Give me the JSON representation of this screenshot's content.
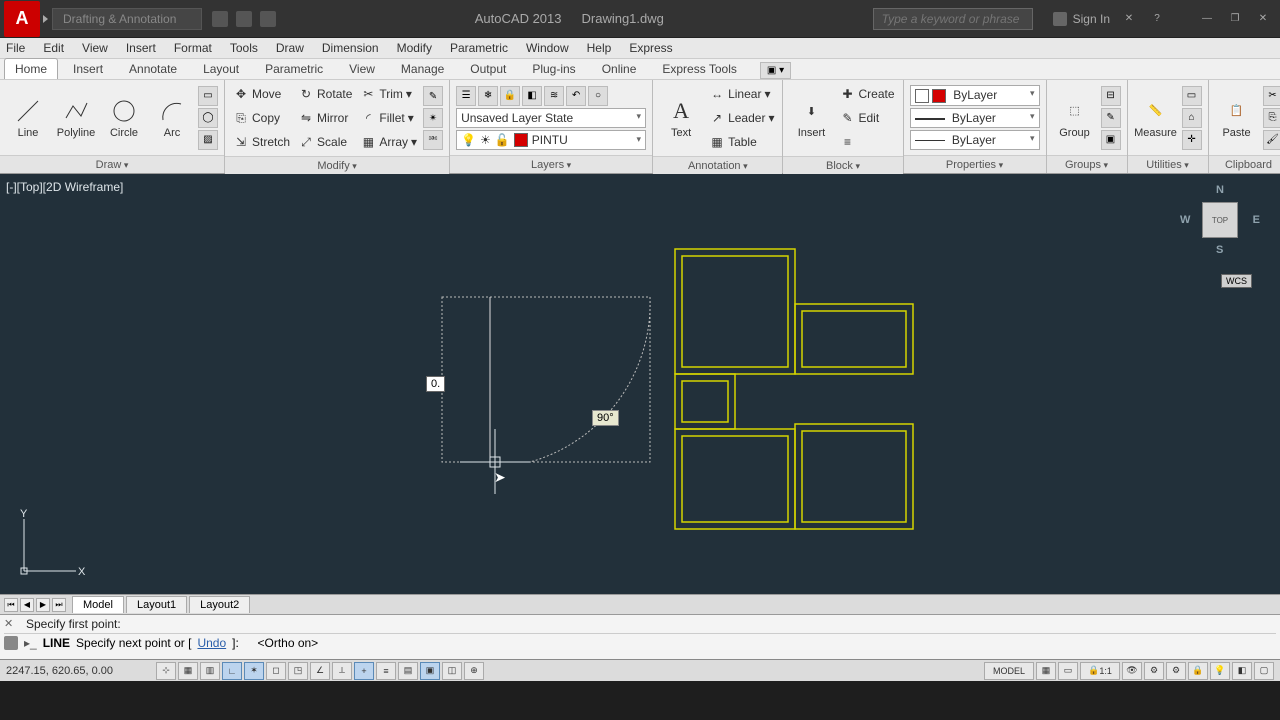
{
  "titlebar": {
    "workspace": "Drafting & Annotation",
    "app": "AutoCAD 2013",
    "doc": "Drawing1.dwg",
    "search_placeholder": "Type a keyword or phrase",
    "signin": "Sign In"
  },
  "menubar": [
    "File",
    "Edit",
    "View",
    "Insert",
    "Format",
    "Tools",
    "Draw",
    "Dimension",
    "Modify",
    "Parametric",
    "Window",
    "Help",
    "Express"
  ],
  "ribbon_tabs": [
    "Home",
    "Insert",
    "Annotate",
    "Layout",
    "Parametric",
    "View",
    "Manage",
    "Output",
    "Plug-ins",
    "Online",
    "Express Tools"
  ],
  "active_tab": "Home",
  "draw_panel": {
    "title": "Draw",
    "items": [
      "Line",
      "Polyline",
      "Circle",
      "Arc"
    ]
  },
  "modify_panel": {
    "title": "Modify",
    "rows": [
      {
        "icon": "move",
        "label": "Move"
      },
      {
        "icon": "copy",
        "label": "Copy"
      },
      {
        "icon": "stretch",
        "label": "Stretch"
      }
    ],
    "rows2": [
      {
        "icon": "rotate",
        "label": "Rotate"
      },
      {
        "icon": "mirror",
        "label": "Mirror"
      },
      {
        "icon": "scale",
        "label": "Scale"
      }
    ],
    "rows3": [
      {
        "icon": "trim",
        "label": "Trim"
      },
      {
        "icon": "fillet",
        "label": "Fillet"
      },
      {
        "icon": "array",
        "label": "Array"
      }
    ]
  },
  "layers_panel": {
    "title": "Layers",
    "state": "Unsaved Layer State",
    "current": "PINTU"
  },
  "annotation_panel": {
    "title": "Annotation",
    "text": "Text",
    "linear": "Linear",
    "leader": "Leader",
    "table": "Table"
  },
  "block_panel": {
    "title": "Block",
    "insert": "Insert",
    "create": "Create",
    "edit": "Edit"
  },
  "properties_panel": {
    "title": "Properties",
    "by1": "ByLayer",
    "by2": "ByLayer",
    "by3": "ByLayer"
  },
  "groups_panel": {
    "title": "Groups",
    "group": "Group"
  },
  "utilities_panel": {
    "title": "Utilities",
    "measure": "Measure"
  },
  "clipboard_panel": {
    "title": "Clipboard",
    "paste": "Paste"
  },
  "canvas": {
    "view_label": "[-][Top][2D Wireframe]",
    "viewcube_face": "TOP",
    "wcs": "WCS",
    "dyn_input": "0.",
    "angle": "90°"
  },
  "layout_tabs": [
    "Model",
    "Layout1",
    "Layout2"
  ],
  "command": {
    "hist": "Specify first point:",
    "cmd": "LINE",
    "prompt_pre": "Specify next point or [",
    "undo": "Undo",
    "prompt_post": "]:",
    "ortho": "<Ortho on>"
  },
  "status": {
    "coords": "2247.15, 620.65, 0.00",
    "model": "MODEL",
    "scale": "1:1"
  }
}
